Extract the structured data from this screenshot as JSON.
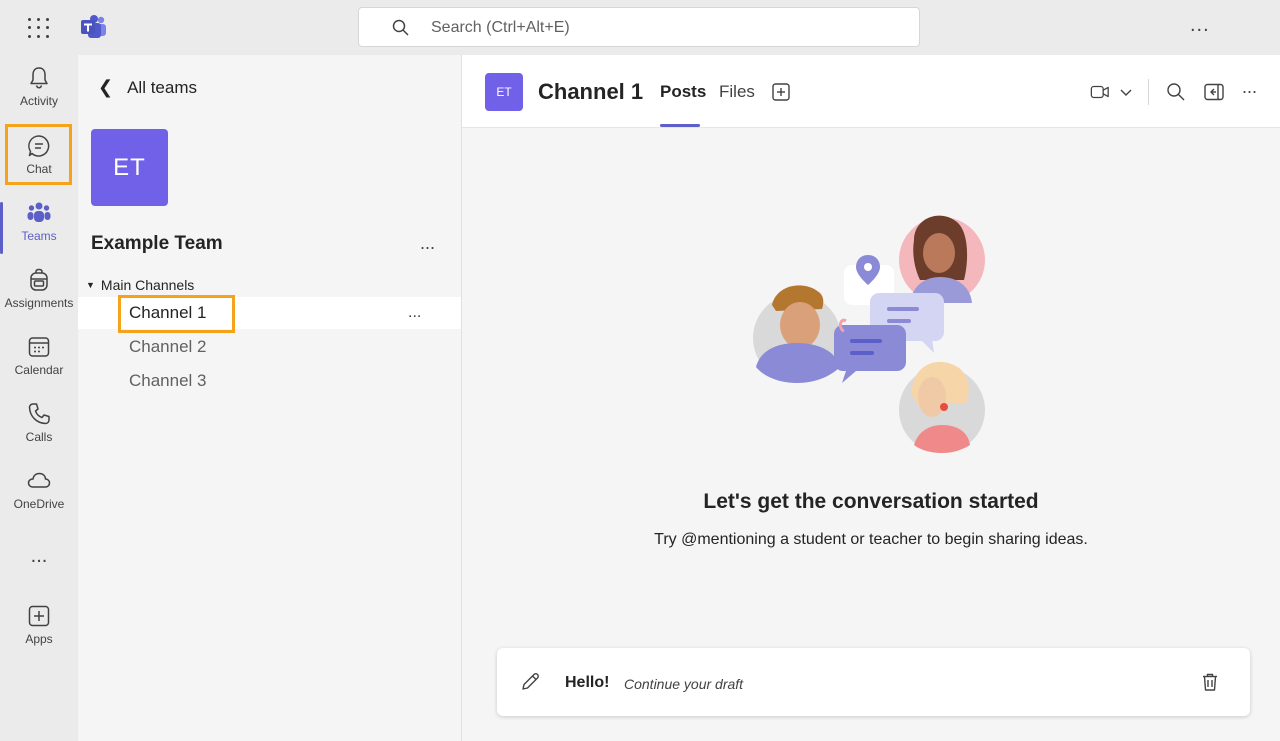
{
  "topbar": {
    "search_placeholder": "Search (Ctrl+Alt+E)",
    "more": "..."
  },
  "rail": {
    "items": [
      {
        "label": "Activity",
        "icon": "bell-icon"
      },
      {
        "label": "Chat",
        "icon": "chat-icon"
      },
      {
        "label": "Teams",
        "icon": "teams-icon",
        "active": true
      },
      {
        "label": "Assignments",
        "icon": "backpack-icon"
      },
      {
        "label": "Calendar",
        "icon": "calendar-icon"
      },
      {
        "label": "Calls",
        "icon": "phone-icon"
      },
      {
        "label": "OneDrive",
        "icon": "cloud-icon"
      },
      {
        "label": "Apps",
        "icon": "add-apps-icon"
      }
    ],
    "more": "..."
  },
  "panel": {
    "back_label": "All teams",
    "team_initials": "ET",
    "team_name": "Example Team",
    "team_more": "...",
    "section": "Main Channels",
    "channels": [
      "Channel 1",
      "Channel 2",
      "Channel 3"
    ],
    "row_more": "..."
  },
  "main": {
    "avatar": "ET",
    "title": "Channel 1",
    "tabs": [
      "Posts",
      "Files"
    ],
    "more": "...",
    "empty_title": "Let's get the conversation started",
    "empty_subtitle": "Try @mentioning a student or teacher to begin sharing ideas.",
    "draft_text": "Hello!",
    "draft_hint": "Continue your draft"
  },
  "colors": {
    "accent": "#5b5fc7",
    "team_tile": "#7160e8",
    "highlight": "#f5a31a"
  }
}
